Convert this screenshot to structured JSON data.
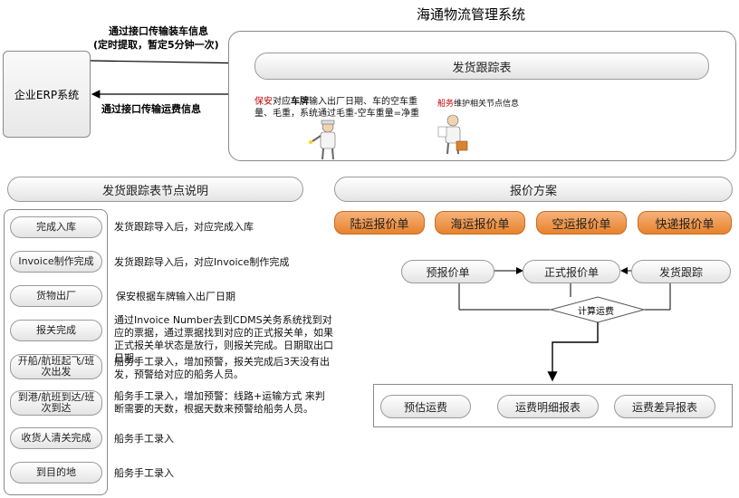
{
  "title": "海通物流管理系统",
  "erp": {
    "label": "企业ERP系统",
    "arrow_top_line1": "通过接口传输装车信息",
    "arrow_top_line2": "(定时提取，暂定5分钟一次)",
    "arrow_bottom": "通过接口传输运费信息"
  },
  "tracking_panel": {
    "header": "发货跟踪表",
    "guard_role": "保安",
    "guard_text_a": "对应",
    "guard_text_bold": "车牌",
    "guard_text_b": "输入出厂日期、车的空车重量、毛重，系统通过毛重-空车重量=净重",
    "clerk_role": "船务",
    "clerk_text": "维护相关节点信息"
  },
  "nodes": {
    "header": "发货跟踪表节点说明",
    "items": [
      {
        "label": "完成入库",
        "desc": "发货跟踪导入后，对应完成入库"
      },
      {
        "label": "Invoice制作完成",
        "desc": "发货跟踪导入后，对应Invoice制作完成"
      },
      {
        "label": "货物出厂",
        "desc": "保安根据车牌输入出厂日期"
      },
      {
        "label": "报关完成",
        "desc": "通过Invoice Number去到CDMS关务系统找到对应的票据，通过票据找到对应的正式报关单，如果正式报关单状态是放行，则报关完成。日期取出口日期。"
      },
      {
        "label": "开船/航班起飞/班次出发",
        "desc": "船务手工录入，增加预警，报关完成后3天没有出发，预警给对应的船务人员。"
      },
      {
        "label": "到港/航班到达/班次到达",
        "desc": "船务手工录入，增加预警：线路+运输方式 来判断需要的天数，根据天数来预警给船务人员。"
      },
      {
        "label": "收货人清关完成",
        "desc": "船务手工录入"
      },
      {
        "label": "到目的地",
        "desc": "船务手工录入"
      }
    ]
  },
  "quote": {
    "header": "报价方案",
    "types": [
      "陆运报价单",
      "海运报价单",
      "空运报价单",
      "快递报价单"
    ],
    "flow": {
      "pre_quote": "预报价单",
      "formal_quote": "正式报价单",
      "tracking": "发货跟踪",
      "calc": "计算运费",
      "reports": [
        "预估运费",
        "运费明细报表",
        "运费差异报表"
      ]
    }
  },
  "colors": {
    "role_red": "#c00000",
    "orange": "#e7822c",
    "border": "#9a9a9a"
  }
}
